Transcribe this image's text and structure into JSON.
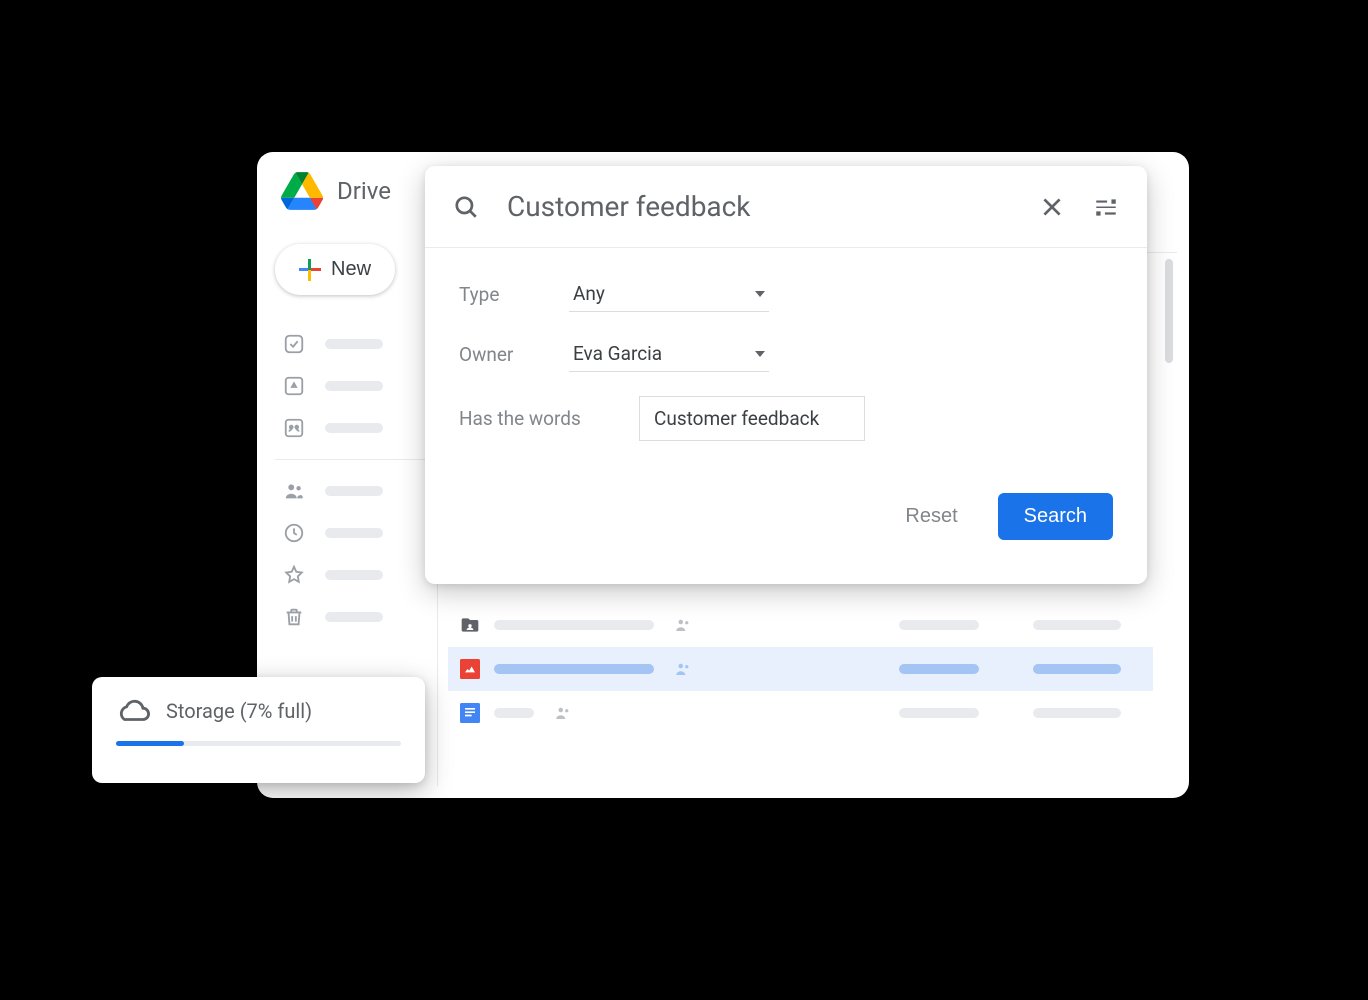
{
  "app": {
    "name": "Drive"
  },
  "newButton": {
    "label": "New"
  },
  "search": {
    "query": "Customer feedback",
    "filters": {
      "typeLabel": "Type",
      "typeValue": "Any",
      "ownerLabel": "Owner",
      "ownerValue": "Eva Garcia",
      "hasWordsLabel": "Has the words",
      "hasWordsValue": "Customer feedback"
    },
    "resetLabel": "Reset",
    "searchLabel": "Search"
  },
  "storage": {
    "label": "Storage (7% full)",
    "percent": 7
  },
  "colors": {
    "accent": "#1a73e8",
    "textSecondary": "#5f6368"
  }
}
